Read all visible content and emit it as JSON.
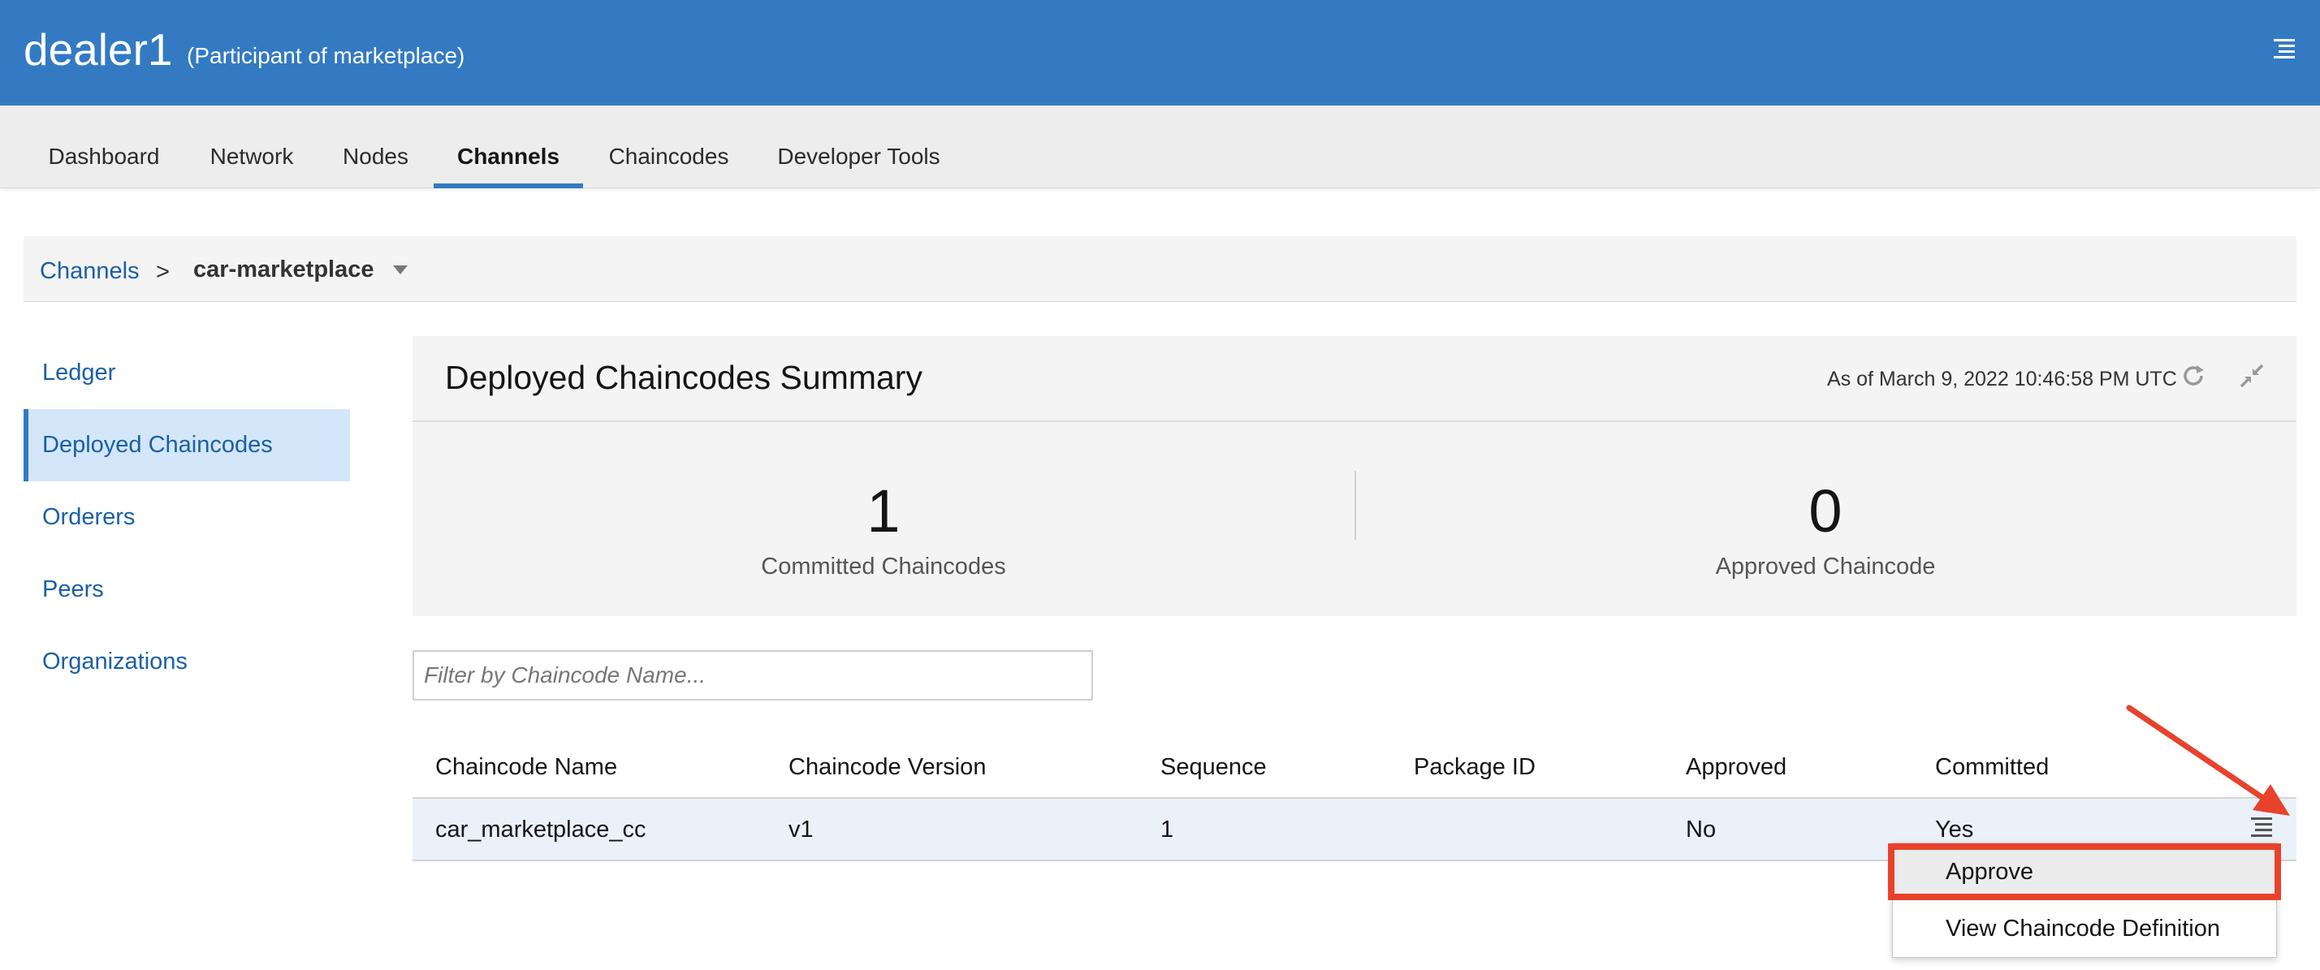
{
  "header": {
    "title": "dealer1",
    "subtitle": "(Participant of marketplace)",
    "menu_icon": "hamburger-menu-icon"
  },
  "topnav": {
    "tabs": [
      {
        "label": "Dashboard"
      },
      {
        "label": "Network"
      },
      {
        "label": "Nodes"
      },
      {
        "label": "Channels",
        "active": true
      },
      {
        "label": "Chaincodes"
      },
      {
        "label": "Developer Tools"
      }
    ]
  },
  "breadcrumb": {
    "root": "Channels",
    "separator": ">",
    "current": "car-marketplace"
  },
  "sidebar": {
    "items": [
      {
        "label": "Ledger"
      },
      {
        "label": "Deployed Chaincodes",
        "active": true
      },
      {
        "label": "Orderers"
      },
      {
        "label": "Peers"
      },
      {
        "label": "Organizations"
      }
    ]
  },
  "summary": {
    "title": "Deployed Chaincodes Summary",
    "timestamp": "As of March 9, 2022 10:46:58 PM UTC",
    "committed_count": "1",
    "committed_label": "Committed Chaincodes",
    "approved_count": "0",
    "approved_label": "Approved Chaincode"
  },
  "filter": {
    "placeholder": "Filter by Chaincode Name..."
  },
  "table": {
    "columns": [
      "Chaincode Name",
      "Chaincode Version",
      "Sequence",
      "Package ID",
      "Approved",
      "Committed"
    ],
    "rows": [
      [
        "car_marketplace_cc",
        "v1",
        "1",
        "",
        "No",
        "Yes"
      ]
    ]
  },
  "row_menu": {
    "items": [
      "Approve",
      "View Chaincode Definition"
    ]
  },
  "colors": {
    "brand": "#337ac3",
    "link": "#1a5fa8",
    "annotation": "#e8422c"
  }
}
